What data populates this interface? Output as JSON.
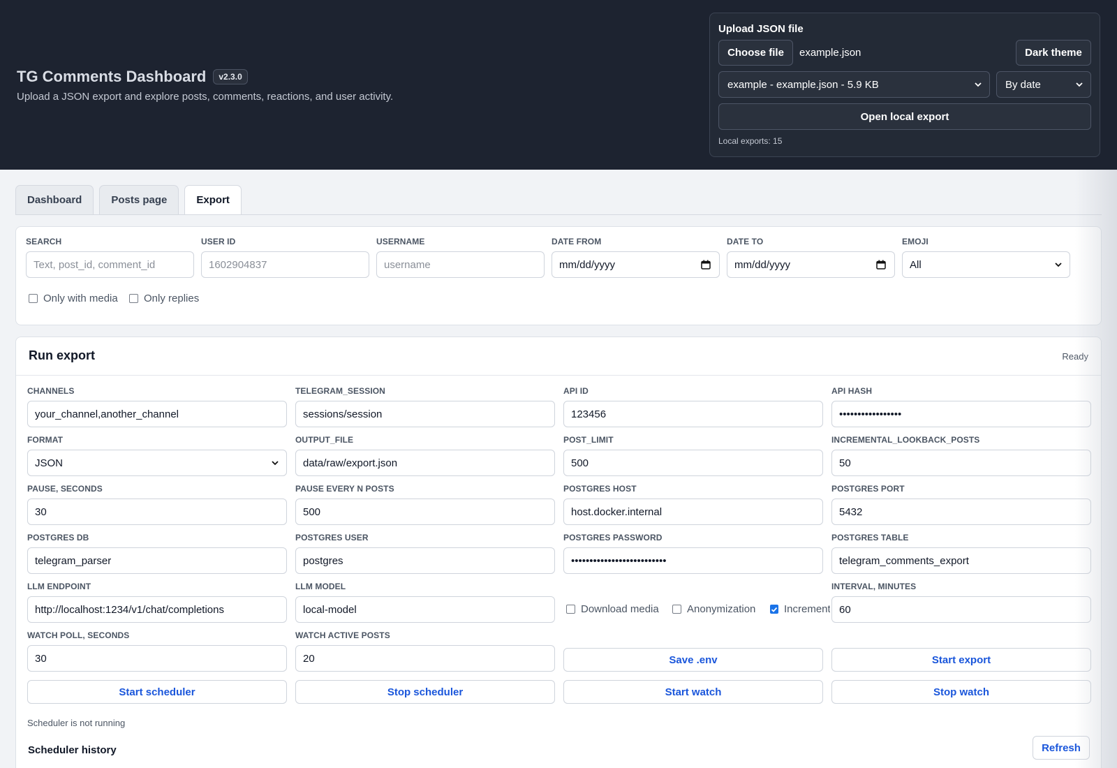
{
  "header": {
    "title": "TG Comments Dashboard",
    "version": "v2.3.0",
    "subtitle": "Upload a JSON export and explore posts, comments, reactions, and user activity."
  },
  "upload": {
    "title": "Upload JSON file",
    "choose_file_label": "Choose file",
    "file_name": "example.json",
    "theme_button": "Dark theme",
    "export_select_value": "example - example.json - 5.9 KB",
    "sort_select_value": "By date",
    "open_button": "Open local export",
    "local_exports": "Local exports: 15"
  },
  "tabs": [
    {
      "label": "Dashboard",
      "active": false
    },
    {
      "label": "Posts page",
      "active": false
    },
    {
      "label": "Export",
      "active": true
    }
  ],
  "filters": {
    "search": {
      "label": "SEARCH",
      "placeholder": "Text, post_id, comment_id"
    },
    "user_id": {
      "label": "USER ID",
      "placeholder": "1602904837"
    },
    "username": {
      "label": "USERNAME",
      "placeholder": "username"
    },
    "date_from": {
      "label": "DATE FROM",
      "value": "mm/dd/yyyy"
    },
    "date_to": {
      "label": "DATE TO",
      "value": "mm/dd/yyyy"
    },
    "emoji": {
      "label": "EMOJI",
      "value": "All"
    },
    "only_media": {
      "label": "Only with media",
      "checked": false
    },
    "only_replies": {
      "label": "Only replies",
      "checked": false
    }
  },
  "export": {
    "title": "Run export",
    "status": "Ready",
    "fields": {
      "channels": {
        "label": "CHANNELS",
        "value": "your_channel,another_channel"
      },
      "telegram_session": {
        "label": "TELEGRAM_SESSION",
        "value": "sessions/session"
      },
      "api_id": {
        "label": "API ID",
        "value": "123456"
      },
      "api_hash": {
        "label": "API HASH",
        "value": "•••••••••••••••••"
      },
      "format": {
        "label": "FORMAT",
        "value": "JSON"
      },
      "output_file": {
        "label": "OUTPUT_FILE",
        "value": "data/raw/export.json"
      },
      "post_limit": {
        "label": "POST_LIMIT",
        "value": "500"
      },
      "incremental_lookback": {
        "label": "INCREMENTAL_LOOKBACK_POSTS",
        "value": "50"
      },
      "pause_seconds": {
        "label": "PAUSE, SECONDS",
        "value": "30"
      },
      "pause_every": {
        "label": "PAUSE EVERY N POSTS",
        "value": "500"
      },
      "postgres_host": {
        "label": "POSTGRES HOST",
        "value": "host.docker.internal"
      },
      "postgres_port": {
        "label": "POSTGRES PORT",
        "value": "5432"
      },
      "postgres_db": {
        "label": "POSTGRES DB",
        "value": "telegram_parser"
      },
      "postgres_user": {
        "label": "POSTGRES USER",
        "value": "postgres"
      },
      "postgres_password": {
        "label": "POSTGRES PASSWORD",
        "value": "••••••••••••••••••••••••••"
      },
      "postgres_table": {
        "label": "POSTGRES TABLE",
        "value": "telegram_comments_export"
      },
      "llm_endpoint": {
        "label": "LLM ENDPOINT",
        "value": "http://localhost:1234/v1/chat/completions"
      },
      "llm_model": {
        "label": "LLM MODEL",
        "value": "local-model"
      },
      "interval_minutes": {
        "label": "INTERVAL, MINUTES",
        "value": "60"
      },
      "watch_poll": {
        "label": "WATCH POLL, SECONDS",
        "value": "30"
      },
      "watch_active": {
        "label": "WATCH ACTIVE POSTS",
        "value": "20"
      }
    },
    "options": {
      "download_media": {
        "label": "Download media",
        "checked": false
      },
      "anonymization": {
        "label": "Anonymization",
        "checked": false
      },
      "incremental": {
        "label": "Increment",
        "checked": true
      }
    },
    "buttons": {
      "save_env": "Save .env",
      "start_export": "Start export",
      "start_scheduler": "Start scheduler",
      "stop_scheduler": "Stop scheduler",
      "start_watch": "Start watch",
      "stop_watch": "Stop watch",
      "refresh": "Refresh"
    },
    "scheduler_status": "Scheduler is not running",
    "history_title": "Scheduler history"
  },
  "colors": {
    "header_bg": "#1d2330",
    "accent": "#1a56db",
    "checkbox_checked": "#1a73e8"
  }
}
